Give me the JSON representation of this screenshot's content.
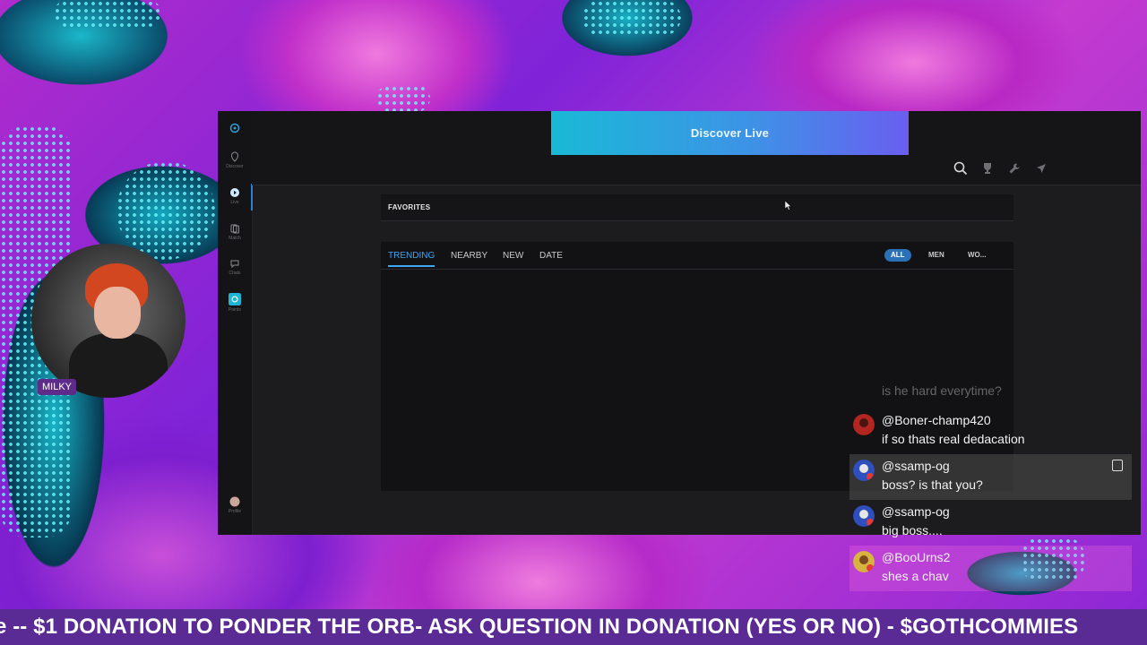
{
  "app": {
    "rail": [
      {
        "label": "",
        "icon": "logo-icon"
      },
      {
        "label": "Discover",
        "icon": "pin-icon"
      },
      {
        "label": "Live",
        "icon": "play-icon"
      },
      {
        "label": "Match",
        "icon": "cards-icon"
      },
      {
        "label": "Chats",
        "icon": "chat-icon"
      },
      {
        "label": "Points",
        "icon": "points-icon"
      },
      {
        "label": "Profile",
        "icon": "avatar-icon"
      }
    ],
    "discover_button": "Discover Live",
    "top_icons": [
      "search-icon",
      "trophy-icon",
      "wrench-icon",
      "send-icon"
    ],
    "favorites_title": "FAVORITES",
    "tabs": [
      "TRENDING",
      "NEARBY",
      "NEW",
      "DATE"
    ],
    "active_tab": "TRENDING",
    "filters": [
      "ALL",
      "MEN",
      "WO..."
    ],
    "active_filter": "ALL",
    "accent": "#3ea6f2"
  },
  "webcam": {
    "label": "MILKY"
  },
  "chat": {
    "ghost_text": "is he hard everytime?",
    "messages": [
      {
        "user": "@Boner-champ420",
        "text": "if so thats real dedacation",
        "avatar_color": "#b2261f"
      },
      {
        "user": "@ssamp-og",
        "text": "boss? is that you?",
        "avatar_color": "#2f4fbf",
        "highlighted": true
      },
      {
        "user": "@ssamp-og",
        "text": "big boss....",
        "avatar_color": "#2f4fbf"
      },
      {
        "user": "@BooUrns2",
        "text": "shes a chav",
        "avatar_color": "#d8b340"
      }
    ]
  },
  "ticker": {
    "text": "e -- $1 DONATION TO PONDER THE ORB- ASK QUESTION IN DONATION (YES OR NO) - $GOTHCOMMIES"
  }
}
